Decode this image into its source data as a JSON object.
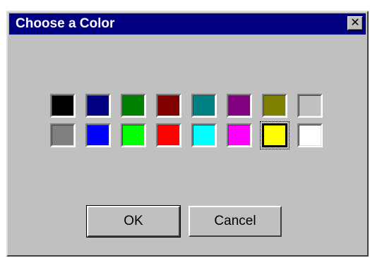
{
  "dialog": {
    "title": "Choose a Color",
    "close_label": "✕"
  },
  "colors": {
    "row1": [
      "#000000",
      "#000080",
      "#008000",
      "#800000",
      "#008080",
      "#800080",
      "#808000",
      "#c0c0c0"
    ],
    "row2": [
      "#808080",
      "#0000ff",
      "#00ff00",
      "#ff0000",
      "#00ffff",
      "#ff00ff",
      "#ffff00",
      "#ffffff"
    ],
    "selected": {
      "row": 2,
      "index": 6
    }
  },
  "buttons": {
    "ok_label": "OK",
    "cancel_label": "Cancel"
  }
}
